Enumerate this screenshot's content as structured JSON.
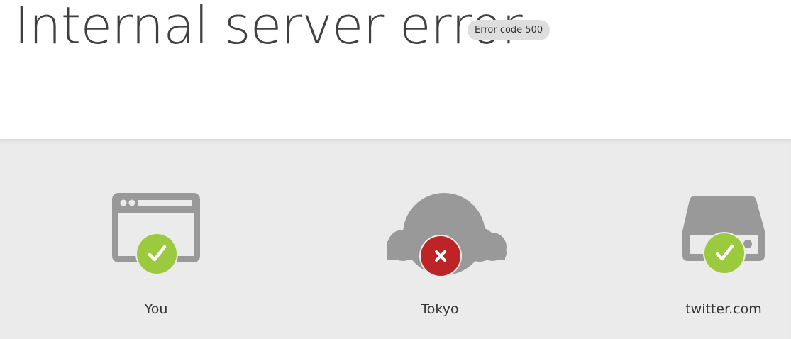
{
  "header": {
    "title": "Internal server error",
    "badge": "Error code 500"
  },
  "nodes": [
    {
      "label": "You",
      "icon": "browser-icon",
      "status": "ok",
      "status_icon": "checkmark-icon"
    },
    {
      "label": "Tokyo",
      "icon": "cloud-icon",
      "status": "error",
      "status_icon": "x-icon"
    },
    {
      "label": "twitter.com",
      "icon": "server-icon",
      "status": "ok",
      "status_icon": "checkmark-icon"
    }
  ],
  "colors": {
    "icon_gray": "#999999",
    "ok_green": "#9bca3e",
    "error_red": "#bd2426",
    "band_bg": "#ebebeb",
    "title_text": "#404040"
  }
}
